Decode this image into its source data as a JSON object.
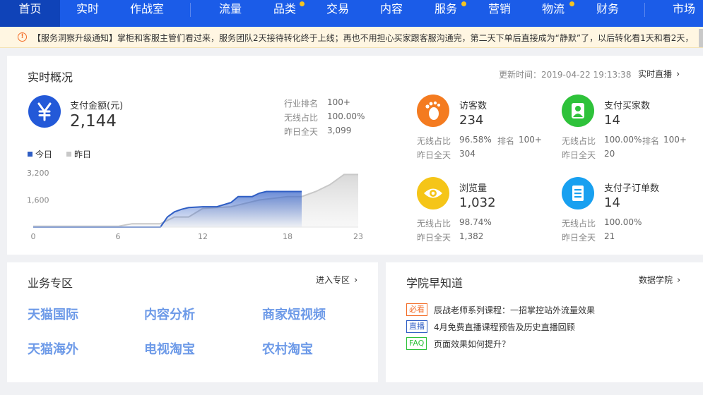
{
  "nav": {
    "items": [
      "首页",
      "实时",
      "作战室",
      "流量",
      "品类",
      "交易",
      "内容",
      "服务",
      "营销",
      "物流",
      "财务",
      "市场"
    ]
  },
  "notice": {
    "text": "【服务洞察升级通知】掌柜和客服主管们看过来，服务团队2天接待转化终于上线；再也不用担心买家跟客服沟通完，第二天下单后直接成为“静默”了，以后转化看1天和看2天，"
  },
  "realtime": {
    "title": "实时概况",
    "update_time": "更新时间：2019-04-22 19:13:38",
    "live_link": "实时直播",
    "pay_label": "支付金额(元)",
    "pay_value": "2,144",
    "stats": [
      {
        "label": "行业排名",
        "value": "100+"
      },
      {
        "label": "无线占比",
        "value": "100.00%"
      },
      {
        "label": "昨日全天",
        "value": "3,099"
      }
    ],
    "legend_today": "今日",
    "legend_yesterday": "昨日",
    "metrics": [
      {
        "label": "访客数",
        "value": "234",
        "mobile_label": "无线占比",
        "mobile": "96.58%",
        "rank_label": "排名",
        "rank": "100+",
        "yday_label": "昨日全天",
        "yday": "304",
        "icon": "footprint-icon",
        "color": "#f47b20"
      },
      {
        "label": "支付买家数",
        "value": "14",
        "mobile_label": "无线占比",
        "mobile": "100.00%",
        "rank_label": "排名",
        "rank": "100+",
        "yday_label": "昨日全天",
        "yday": "20",
        "icon": "buyers-icon",
        "color": "#2ec23a"
      },
      {
        "label": "浏览量",
        "value": "1,032",
        "mobile_label": "无线占比",
        "mobile": "98.74%",
        "yday_label": "昨日全天",
        "yday": "1,382",
        "icon": "eye-icon",
        "color": "#f5c518"
      },
      {
        "label": "支付子订单数",
        "value": "14",
        "mobile_label": "无线占比",
        "mobile": "100.00%",
        "yday_label": "昨日全天",
        "yday": "21",
        "icon": "order-icon",
        "color": "#18a0f0"
      }
    ]
  },
  "chart_data": {
    "type": "area",
    "x_ticks": [
      "0",
      "6",
      "12",
      "18",
      "23"
    ],
    "y_ticks": [
      "3,200",
      "1,600"
    ],
    "ylim": [
      0,
      3200
    ],
    "xlim": [
      0,
      23
    ],
    "series": [
      {
        "name": "今日",
        "color": "#2f5ec4",
        "x": [
          0,
          9,
          9.5,
          10,
          10.5,
          11,
          12,
          13,
          14,
          14.5,
          15,
          15.5,
          16,
          16.5,
          17,
          18,
          19
        ],
        "values": [
          0,
          0,
          600,
          900,
          1050,
          1150,
          1200,
          1200,
          1450,
          1800,
          1800,
          1800,
          2000,
          2100,
          2100,
          2100,
          2100
        ]
      },
      {
        "name": "昨日",
        "color": "#c8c8c8",
        "x": [
          0,
          6,
          7,
          9,
          10,
          11,
          12,
          13,
          14,
          15,
          16,
          17,
          18,
          19,
          20,
          21,
          22,
          23
        ],
        "values": [
          50,
          50,
          200,
          200,
          600,
          600,
          1100,
          1150,
          1200,
          1400,
          1600,
          1700,
          1800,
          1800,
          2100,
          2500,
          3099,
          3099
        ]
      }
    ]
  },
  "business": {
    "title": "业务专区",
    "enter_link": "进入专区",
    "links": [
      "天猫国际",
      "内容分析",
      "商家短视频",
      "天猫海外",
      "电视淘宝",
      "农村淘宝"
    ]
  },
  "academy": {
    "title": "学院早知道",
    "link": "数据学院",
    "items": [
      {
        "tag": "必看",
        "tag_color": "#f36b25",
        "text": "辰战老师系列课程：一招掌控站外流量效果"
      },
      {
        "tag": "直播",
        "tag_color": "#2f5ec4",
        "text": "4月免费直播课程预告及历史直播回顾"
      },
      {
        "tag": "FAQ",
        "tag_color": "#2ec23a",
        "text": "页面效果如何提升？"
      }
    ]
  }
}
